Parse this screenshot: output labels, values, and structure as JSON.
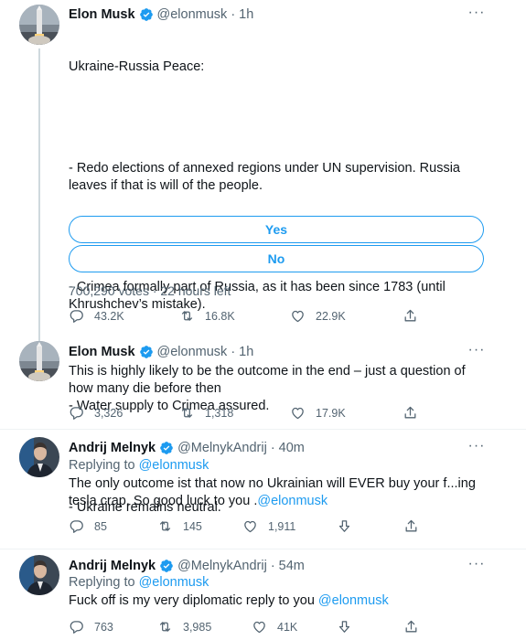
{
  "tweets": [
    {
      "name": "Elon Musk",
      "handle": "@elonmusk · 1h",
      "lines": [
        "Ukraine-Russia Peace:",
        "- Redo elections of annexed regions under UN supervision. Russia leaves if that is will of the people.",
        "- Crimea formally part of Russia, as it has been since 1783 (until Khrushchev’s mistake).",
        "- Water supply to Crimea assured.",
        "- Ukraine remains neutral."
      ],
      "poll": {
        "options": [
          "Yes",
          "No"
        ],
        "meta": "700,290 votes · 22 hours left"
      },
      "stats": {
        "replies": "43.2K",
        "retweets": "16.8K",
        "likes": "22.9K"
      }
    },
    {
      "name": "Elon Musk",
      "handle": "@elonmusk · 1h",
      "text": "This is highly likely to be the outcome in the end – just a question of how many die before then",
      "stats": {
        "replies": "3,326",
        "retweets": "1,318",
        "likes": "17.9K"
      }
    },
    {
      "name": "Andrij Melnyk",
      "handle": "@MelnykAndrij · 40m",
      "replying_label": "Replying to",
      "replying_to": "@elonmusk",
      "text": "The only outcome ist that now no Ukrainian will EVER buy your f...ing tesla crap. So good luck to you .",
      "mention": "@elonmusk",
      "stats": {
        "replies": "85",
        "retweets": "145",
        "likes": "1,911"
      }
    },
    {
      "name": "Andrij Melnyk",
      "handle": "@MelnykAndrij · 54m",
      "replying_label": "Replying to",
      "replying_to": "@elonmusk",
      "text": "Fuck off is my very diplomatic reply to you ",
      "mention": "@elonmusk",
      "stats": {
        "replies": "763",
        "retweets": "3,985",
        "likes": "41K"
      }
    }
  ],
  "colors": {
    "accent": "#1d9bf0",
    "text": "#0f1419",
    "secondary": "#536471",
    "thread_line": "#cfd9de",
    "divider": "#eff3f4"
  },
  "icons": [
    "verified-badge-icon",
    "more-icon",
    "reply-icon",
    "retweet-icon",
    "like-icon",
    "share-icon",
    "downvote-icon"
  ]
}
